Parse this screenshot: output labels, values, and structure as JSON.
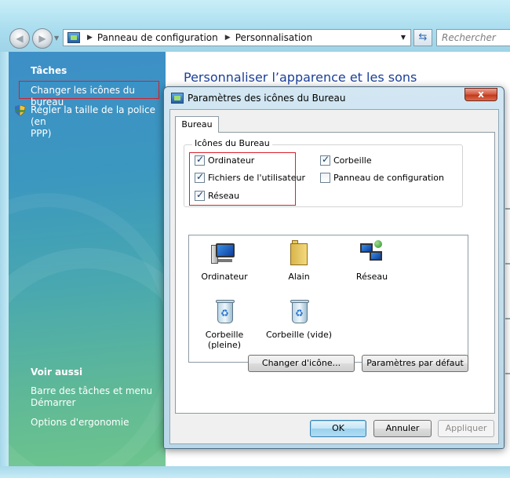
{
  "nav": {
    "back_icon": "back-arrow-icon",
    "forward_icon": "forward-arrow-icon",
    "breadcrumb": [
      "Panneau de configuration",
      "Personnalisation"
    ],
    "search_placeholder": "Rechercher"
  },
  "taskpane": {
    "tasks_heading": "Tâches",
    "task_change_icons": "Changer les icônes du bureau",
    "task_font_size_line1": "Régler la taille de la police (en",
    "task_font_size_line2": "PPP)",
    "see_also_heading": "Voir aussi",
    "link_taskbar_line1": "Barre des tâches et menu",
    "link_taskbar_line2": "Démarrer",
    "link_ergonomics": "Options d'ergonomie"
  },
  "main": {
    "title": "Personnaliser l’apparence et les sons"
  },
  "dialog": {
    "title": "Paramètres des icônes du Bureau",
    "close_label": "x",
    "tab_label": "Bureau",
    "group_label": "Icônes du Bureau",
    "checkboxes": [
      {
        "label": "Ordinateur",
        "checked": true
      },
      {
        "label": "Fichiers de l'utilisateur",
        "checked": true
      },
      {
        "label": "Réseau",
        "checked": true
      },
      {
        "label": "Corbeille",
        "checked": true
      },
      {
        "label": "Panneau de configuration",
        "checked": false
      }
    ],
    "icons": [
      {
        "label": "Ordinateur",
        "icon": "computer-icon"
      },
      {
        "label": "Alain",
        "icon": "user-folder-icon"
      },
      {
        "label": "Réseau",
        "icon": "network-icon"
      },
      {
        "label": "Corbeille (pleine)",
        "icon": "recycle-bin-full-icon"
      },
      {
        "label": "Corbeille (vide)",
        "icon": "recycle-bin-empty-icon"
      }
    ],
    "change_icon_button": "Changer d'icône...",
    "default_button": "Paramètres par défaut",
    "ok_button": "OK",
    "cancel_button": "Annuler",
    "apply_button": "Appliquer"
  }
}
